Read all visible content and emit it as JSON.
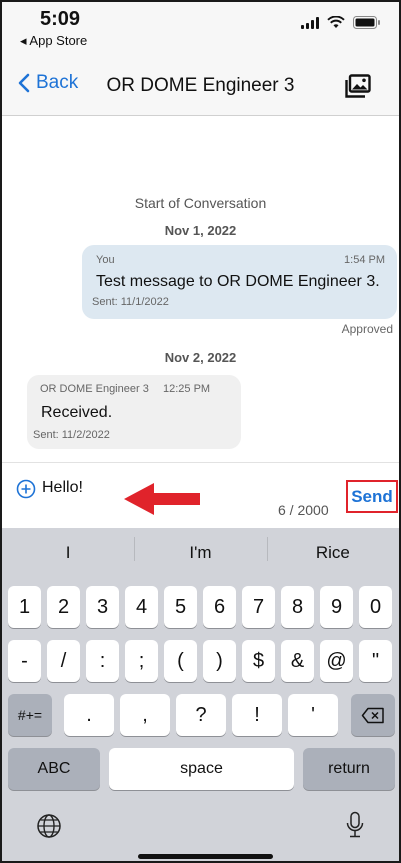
{
  "status_bar": {
    "time": "5:09",
    "back_app": "◂ App Store",
    "signal_icon": "signal-bars-icon",
    "wifi_icon": "wifi-icon",
    "battery_icon": "battery-icon"
  },
  "nav": {
    "back_label": "Back",
    "title": "OR DOME Engineer 3",
    "gallery_icon": "photo-gallery-icon"
  },
  "conversation": {
    "start_label": "Start of Conversation",
    "groups": [
      {
        "date": "Nov 1, 2022",
        "message": {
          "direction": "outgoing",
          "sender": "You",
          "time": "1:54 PM",
          "text": "Test message to OR DOME Engineer 3.",
          "sent": "Sent: 11/1/2022",
          "status": "Approved"
        }
      },
      {
        "date": "Nov 2, 2022",
        "message": {
          "direction": "incoming",
          "sender": "OR DOME Engineer 3",
          "time": "12:25 PM",
          "text": "Received.",
          "sent": "Sent: 11/2/2022"
        }
      }
    ]
  },
  "composer": {
    "value": "Hello!",
    "counter": "6 / 2000",
    "send_label": "Send",
    "annotation_color": "#e0232b"
  },
  "keyboard": {
    "suggestions": [
      "I",
      "I'm",
      "Rice"
    ],
    "row1": [
      "1",
      "2",
      "3",
      "4",
      "5",
      "6",
      "7",
      "8",
      "9",
      "0"
    ],
    "row2": [
      "-",
      "/",
      ":",
      ";",
      "(",
      ")",
      "$",
      "&",
      "@",
      "\""
    ],
    "row3_mode": "#+=",
    "row3": [
      ".",
      ",",
      "?",
      "!",
      "'"
    ],
    "abc_label": "ABC",
    "space_label": "space",
    "return_label": "return"
  },
  "accent_color": "#1e73d6"
}
